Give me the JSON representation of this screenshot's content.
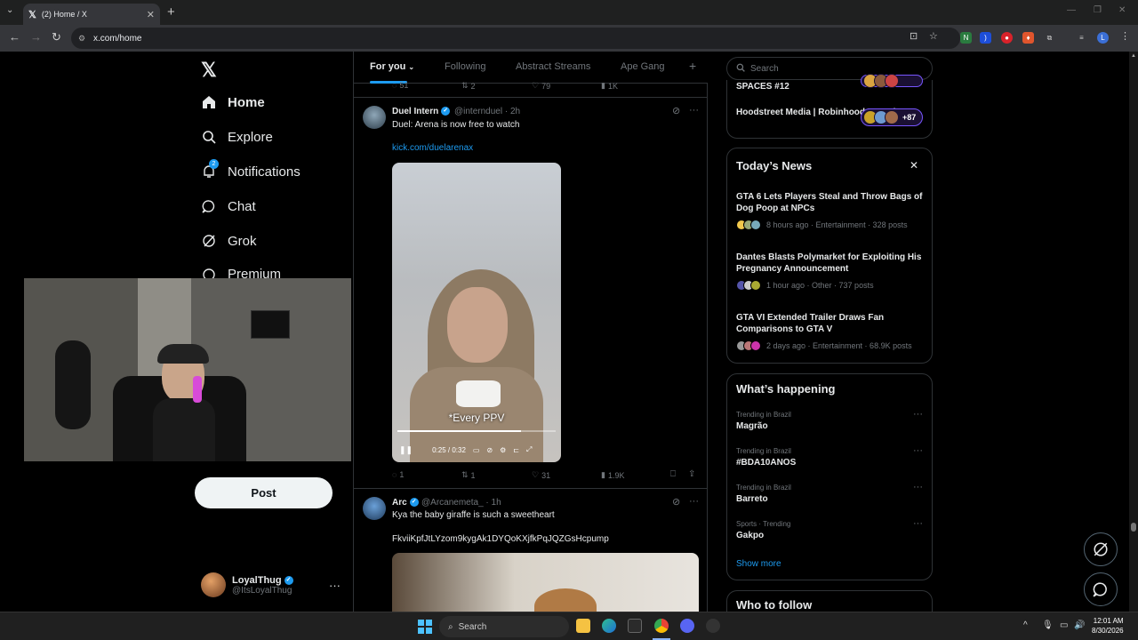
{
  "browser": {
    "tab_title": "(2) Home / X",
    "url": "x.com/home"
  },
  "nav": {
    "home": "Home",
    "explore": "Explore",
    "notifications": "Notifications",
    "notifications_badge": "2",
    "chat": "Chat",
    "grok": "Grok",
    "premium": "Premium",
    "post_button": "Post",
    "account_name": "LoyalThug",
    "account_handle": "@ItsLoyalThug"
  },
  "timeline": {
    "tabs": [
      "For you",
      "Following",
      "Abstract Streams",
      "Ape Gang"
    ],
    "prev_actions": {
      "replies": "51",
      "reposts": "2",
      "likes": "79",
      "views": "1K"
    },
    "tweets": [
      {
        "name": "Duel Intern",
        "handle": "@internduel",
        "time": "· 2h",
        "text": "Duel: Arena is now free to watch",
        "link": "kick.com/duelarenax",
        "video_caption": "*Every PPV",
        "video_time": "0:25 / 0:32",
        "replies": "1",
        "reposts": "1",
        "likes": "31",
        "views": "1.9K"
      },
      {
        "name": "Arc",
        "handle": "@Arcanemeta_",
        "time": "· 1h",
        "text": "Kya the baby giraffe is such a sweetheart",
        "text2": "FkviiKpfJtLYzom9kygAk1DYQoKXjfkPqJQZGsHcpump"
      }
    ]
  },
  "sidebar": {
    "search_placeholder": "Search",
    "spaces": [
      {
        "name": "SPACES #12"
      },
      {
        "name": "Hoodstreet Media | Robinhood NFTS | ...",
        "count": "+87"
      }
    ],
    "news_title": "Today’s News",
    "news": [
      {
        "title": "GTA 6 Lets Players Steal and Throw Bags of Dog Poop at NPCs",
        "meta": "8 hours ago · Entertainment · 328 posts"
      },
      {
        "title": "Dantes Blasts Polymarket for Exploiting His Pregnancy Announcement",
        "meta": "1 hour ago · Other · 737 posts"
      },
      {
        "title": "GTA VI Extended Trailer Draws Fan Comparisons to GTA V",
        "meta": "2 days ago · Entertainment · 68.9K posts"
      }
    ],
    "happening_title": "What’s happening",
    "trends": [
      {
        "context": "Trending in Brazil",
        "name": "Magrão"
      },
      {
        "context": "Trending in Brazil",
        "name": "#BDA10ANOS"
      },
      {
        "context": "Trending in Brazil",
        "name": "Barreto"
      },
      {
        "context": "Sports · Trending",
        "name": "Gakpo"
      }
    ],
    "show_more": "Show more",
    "who_to_follow": "Who to follow"
  },
  "taskbar": {
    "search": "Search",
    "time": "12:01 AM",
    "date": "8/30/2026"
  },
  "colors": {
    "accent": "#1d9bf0",
    "background": "#000000",
    "border": "#2f3336",
    "muted_text": "#71767b"
  }
}
